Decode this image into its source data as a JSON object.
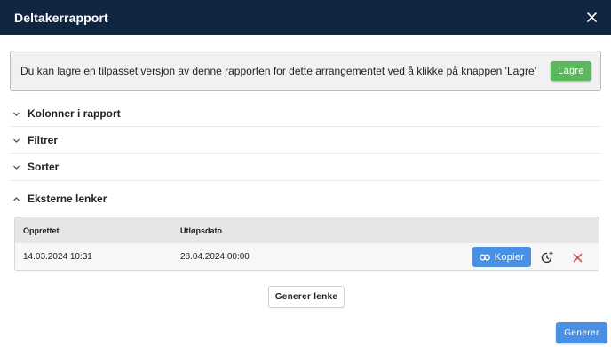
{
  "dialog": {
    "title": "Deltakerrapport"
  },
  "info": {
    "message": "Du kan lagre en tilpasset versjon av denne rapporten for dette arrangementet ved å klikke på knappen 'Lagre'",
    "save_label": "Lagre"
  },
  "sections": [
    {
      "label": "Kolonner i rapport",
      "expanded": false
    },
    {
      "label": "Filtrer",
      "expanded": false
    },
    {
      "label": "Sorter",
      "expanded": false
    },
    {
      "label": "Eksterne lenker",
      "expanded": true
    }
  ],
  "links_table": {
    "columns": [
      "Opprettet",
      "Utløpsdato"
    ],
    "rows": [
      {
        "created": "14.03.2024 10:31",
        "expires": "28.04.2024 00:00",
        "copy_label": "Kopier"
      }
    ]
  },
  "generate_link_label": "Generer lenke",
  "generate_label": "Generer",
  "colors": {
    "header_bg": "#0f2540",
    "save_green": "#5cb85c",
    "primary_blue": "#4a90e2",
    "delete_red": "#d9534f"
  },
  "icons": {
    "close": "close-icon",
    "collapsed": "chevron-down-icon",
    "expanded": "chevron-up-icon",
    "copy": "link-icon",
    "extend": "clock-plus-icon",
    "delete": "x-icon"
  }
}
